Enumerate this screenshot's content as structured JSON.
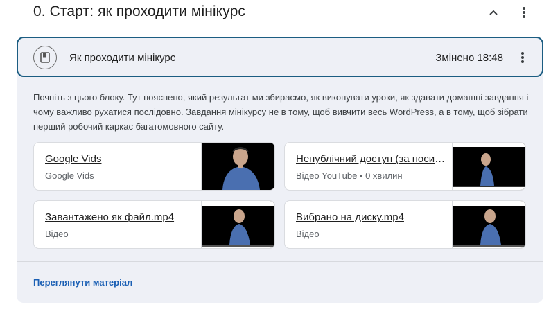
{
  "topic": {
    "title": "0. Старт: як проходити мінікурс",
    "collapse_icon": "chevron-up-icon",
    "more_icon": "more-vert-icon"
  },
  "material": {
    "icon": "book-icon",
    "title": "Як проходити мінікурс",
    "modified": "Змінено 18:48",
    "more_icon": "more-vert-icon",
    "description": "Почніть з цього блоку. Тут пояснено, який результат ми збираємо, як виконувати уроки, як здавати домашні завдання і чому важливо рухатися послідовно. Завдання мінікурсу не в тому, щоб вивчити весь WordPress, а в тому, щоб зібрати перший робочий каркас багатомовного сайту.",
    "attachments": [
      {
        "title": "Google Vids",
        "subtitle": "Google Vids"
      },
      {
        "title": "Непублічний доступ (за посиланням)",
        "subtitle": "Відео YouTube • 0 хвилин"
      },
      {
        "title": "Завантажено як файл.mp4",
        "subtitle": "Відео"
      },
      {
        "title": "Вибрано на диску.mp4",
        "subtitle": "Відео"
      }
    ],
    "view_link": "Переглянути матеріал"
  },
  "colors": {
    "accent_border": "#1b5d82",
    "card_bg": "#eef0f6",
    "link": "#1a5fb4",
    "person_shirt": "#4a6fb0"
  }
}
